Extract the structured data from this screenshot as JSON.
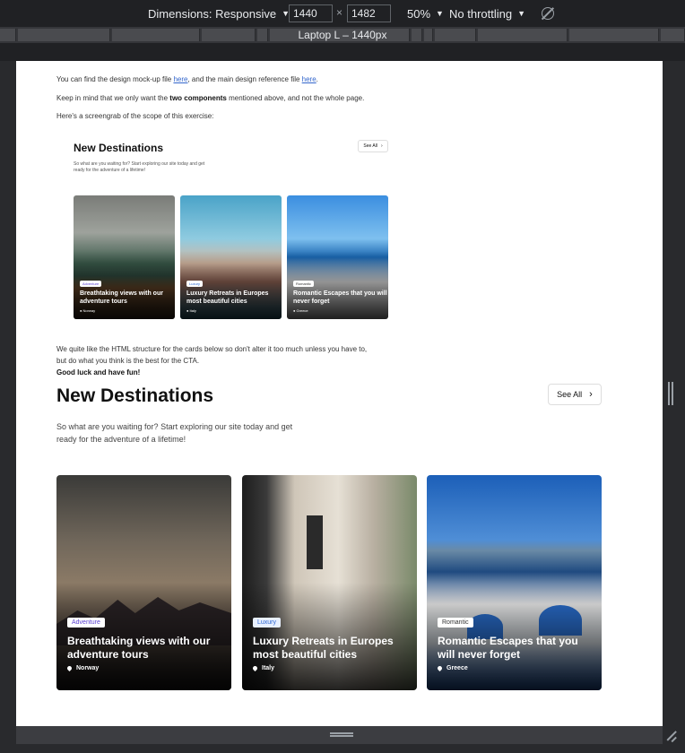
{
  "devtools": {
    "dimensions_label": "Dimensions: Responsive",
    "width_value": "1440",
    "height_value": "1482",
    "times": "×",
    "zoom": "50%",
    "throttling": "No throttling",
    "media_query_label": "Laptop L – 1440px"
  },
  "intro": {
    "line1_pre": "You can find the design mock-up file ",
    "line1_link1": "here",
    "line1_mid": ", and the main design reference file ",
    "line1_link2": "here",
    "line1_post": ".",
    "line2_pre": "Keep in mind that we only want the ",
    "line2_bold": "two components",
    "line2_post": " mentioned above, and not the whole page.",
    "line3": "Here's a screengrab of the scope of this exercise:",
    "after1": "We quite like the HTML structure for the cards below so don't alter it too much unless you have to,",
    "after2": "but do what you think is the best for the CTA.",
    "after3": "Good luck and have fun!"
  },
  "mock": {
    "title": "New Destinations",
    "subtitle": "So what are you waiting for? Start exploring our site today and get ready for the adventure of a lifetime!",
    "see_all": "See All",
    "cards": [
      {
        "tag": "Adventure",
        "title": "Breathtaking views with our adventure tours",
        "location": "Norway"
      },
      {
        "tag": "Luxury",
        "title": "Luxury Retreats in Europes most beautiful cities",
        "location": "Italy"
      },
      {
        "tag": "Romantic",
        "title": "Romantic Escapes that you will never forget",
        "location": "Greece"
      }
    ]
  },
  "section": {
    "title": "New Destinations",
    "see_all": "See All",
    "subtitle": "So what are you waiting for? Start exploring our site today and get ready for the adventure of a lifetime!",
    "cards": [
      {
        "tag": "Adventure",
        "title": "Breathtaking views with our adventure tours",
        "location": "Norway",
        "tag_color": "#5a3fd0"
      },
      {
        "tag": "Luxury",
        "title": "Luxury Retreats in Europes most beautiful cities",
        "location": "Italy",
        "tag_color": "#2a66d0"
      },
      {
        "tag": "Romantic",
        "title": "Romantic Escapes that you will never forget",
        "location": "Greece",
        "tag_color": "#333333"
      }
    ]
  }
}
